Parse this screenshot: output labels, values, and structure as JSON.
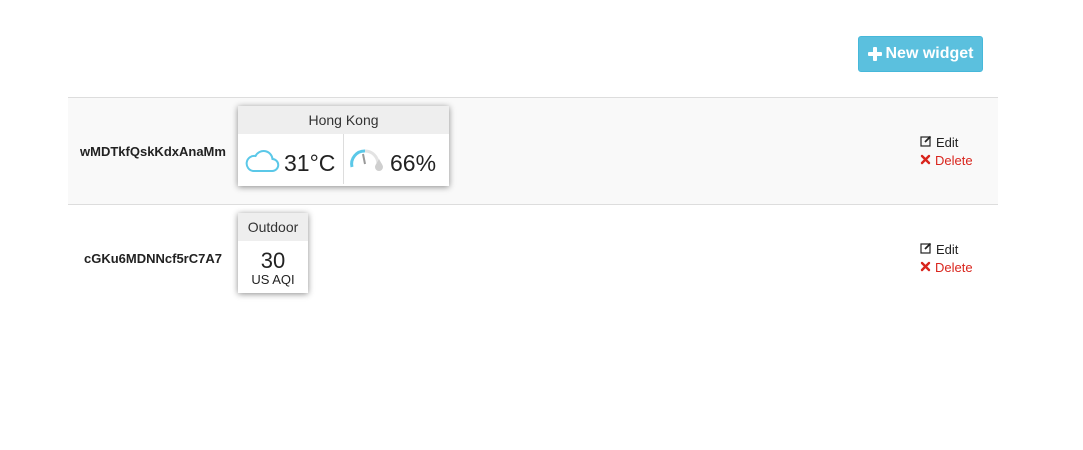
{
  "toolbar": {
    "new_widget_label": "New widget"
  },
  "rows": [
    {
      "id": "wMDTkfQskKdxAnaMm",
      "widget": {
        "title": "Hong Kong",
        "temperature": "31°C",
        "humidity": "66%",
        "weather_icon": "cloud-icon",
        "humidity_icon": "humidity-gauge-icon"
      },
      "actions": {
        "edit": "Edit",
        "delete": "Delete"
      }
    },
    {
      "id": "cGKu6MDNNcf5rC7A7",
      "widget": {
        "title": "Outdoor",
        "value": "30",
        "unit": "US AQI"
      },
      "actions": {
        "edit": "Edit",
        "delete": "Delete"
      }
    }
  ],
  "colors": {
    "button_bg": "#5bc0de",
    "delete": "#d9251d",
    "row_alt_bg": "#f9f9f9",
    "icon_blue": "#5bc8e8"
  }
}
